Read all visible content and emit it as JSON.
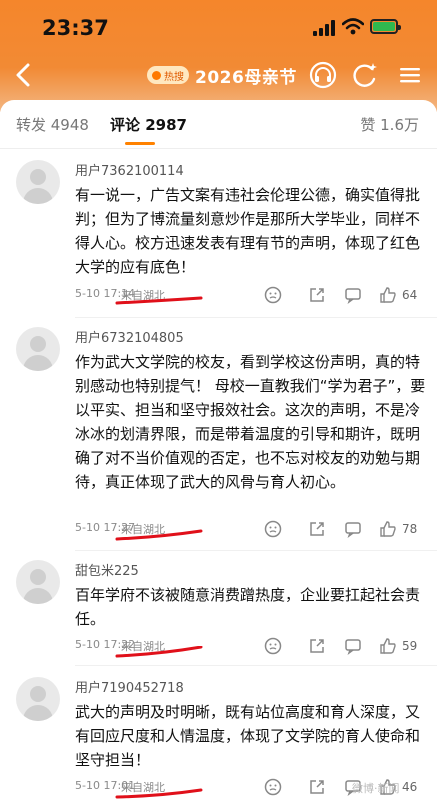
{
  "status_bar": {
    "time": "23:37"
  },
  "nav": {
    "tag": "热搜",
    "title": "2026母亲节"
  },
  "tabs": {
    "repost": "转发 4948",
    "comments": "评论 2987",
    "likes": "赞 1.6万"
  },
  "comments": [
    {
      "user": "用户7362100114",
      "text": "有一说一，广告文案有违社会伦理公德，确实值得批判；但为了博流量刻意炒作是那所大学毕业，同样不得人心。校方迅速发表有理有节的声明，体现了红色大学的应有底色！",
      "date": "5-10 17:14",
      "location": "来自湖北",
      "likes": "64"
    },
    {
      "user": "用户6732104805",
      "text": "作为武大文学院的校友，看到学校这份声明，真的特别感动也特别提气！ 母校一直教我们“学为君子”，要以平实、担当和坚守报效社会。这次的声明，不是冷冰冰的划清界限，而是带着温度的引导和期许，既明确了对不当价值观的否定，也不忘对校友的劝勉与期待，真正体现了武大的风骨与育人初心。",
      "date": "5-10 17:27",
      "location": "来自湖北",
      "likes": "78"
    },
    {
      "user": "甜包米225",
      "text": "百年学府不该被随意消费蹭热度，企业要扛起社会责任。",
      "date": "5-10 17:22",
      "location": "来自湖北",
      "likes": "59"
    },
    {
      "user": "用户7190452718",
      "text": "武大的声明及时明晰，既有站位高度和育人深度，又有回应尺度和人情温度，体现了文学院的育人使命和坚守担当！",
      "date": "5-10 17:01",
      "location": "来自湖北",
      "likes": "46"
    }
  ],
  "watermark": "微博·新闻",
  "colors": {
    "header": "#f5862b",
    "accent": "#ff8200",
    "annotation": "#e0101a"
  }
}
